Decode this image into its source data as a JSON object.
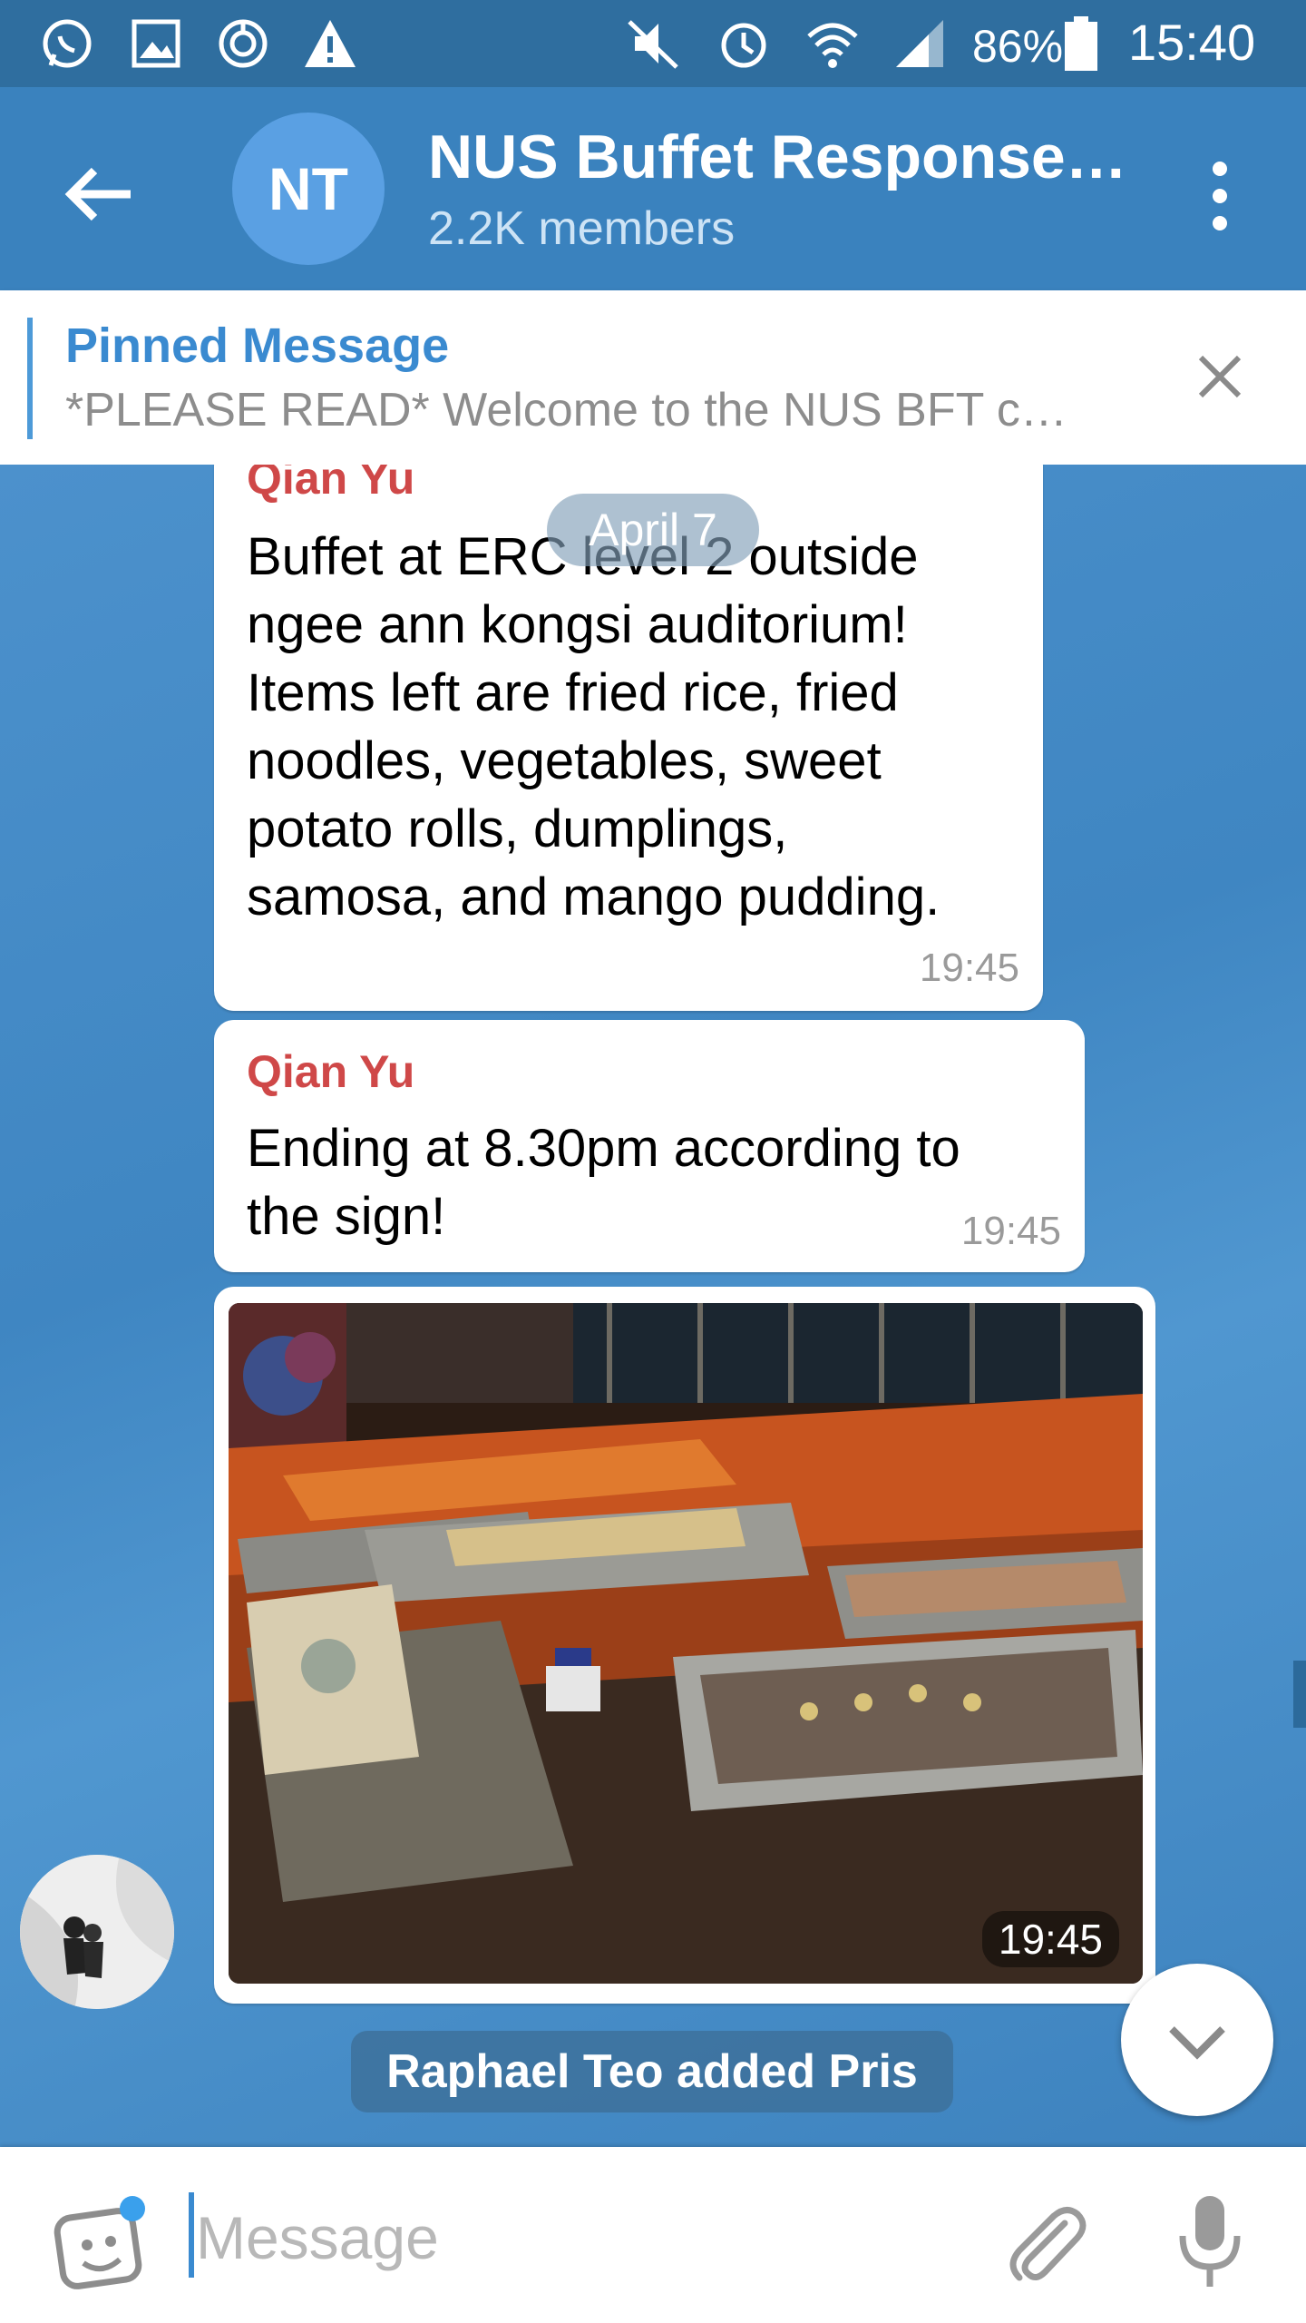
{
  "status_bar": {
    "icons": [
      "whatsapp-icon",
      "gallery-icon",
      "sync-icon",
      "warning-icon",
      "mute-icon",
      "alarm-icon",
      "wifi-icon",
      "signal-icon",
      "battery-icon"
    ],
    "battery": "86%",
    "time": "15:40"
  },
  "header": {
    "avatar_initials": "NT",
    "title": "NUS Buffet Response…",
    "members": "2.2K members",
    "colors": {
      "bar": "#3a82be",
      "avatar": "#5aa0e3"
    }
  },
  "pinned": {
    "title": "Pinned Message",
    "text": "*PLEASE READ*  Welcome to the NUS BFT c…"
  },
  "date_label": "April 7",
  "messages": [
    {
      "sender": "Qian Yu",
      "lines": [
        "Buffet at ERC level 2 outside",
        "ngee ann kongsi auditorium!",
        "Items left are fried rice, fried",
        "noodles, vegetables, sweet",
        "potato rolls, dumplings,",
        "samosa, and mango pudding."
      ],
      "time": "19:45"
    },
    {
      "sender": "Qian Yu",
      "lines": [
        "Ending at 8.30pm according to",
        "the sign!"
      ],
      "time": "19:45"
    },
    {
      "type": "photo",
      "time": "19:45"
    }
  ],
  "system_message": "Raphael Teo added Pris",
  "input": {
    "placeholder": "Message"
  },
  "accent_color": "#3a8ad0",
  "sender_color": "#cf4848"
}
